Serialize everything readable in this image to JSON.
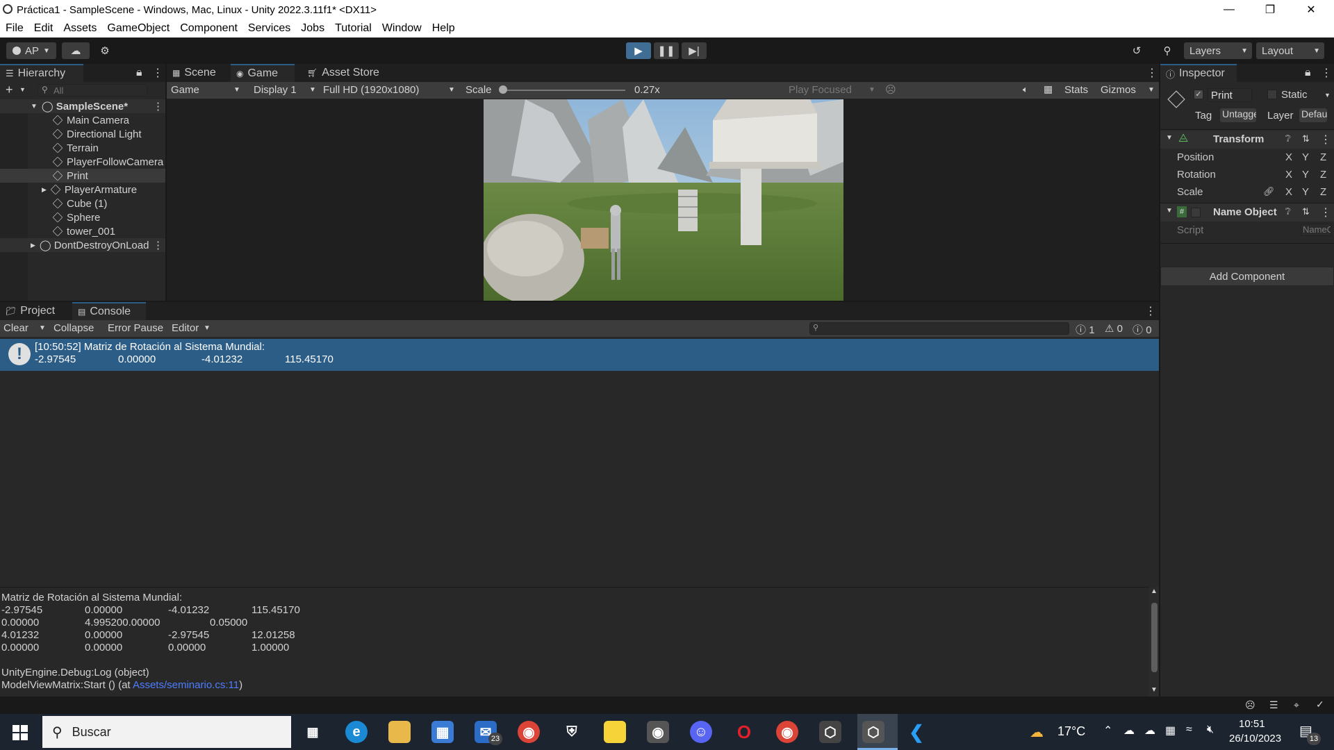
{
  "window": {
    "title": "Práctica1 - SampleScene - Windows, Mac, Linux - Unity 2022.3.11f1* <DX11>",
    "minimize_icon": "minimize-icon",
    "maximize_icon": "restore-icon",
    "close_icon": "close-icon"
  },
  "menu": [
    "File",
    "Edit",
    "Assets",
    "GameObject",
    "Component",
    "Services",
    "Jobs",
    "Tutorial",
    "Window",
    "Help"
  ],
  "toolbar": {
    "account": "AP",
    "layers": "Layers",
    "layout": "Layout"
  },
  "hierarchy": {
    "tab": "Hierarchy",
    "search_placeholder": "All",
    "scene": "SampleScene*",
    "items": [
      "Main Camera",
      "Directional Light",
      "Terrain",
      "PlayerFollowCamera",
      "Print",
      "PlayerArmature",
      "Cube (1)",
      "Sphere",
      "tower_001"
    ],
    "dont_destroy": "DontDestroyOnLoad"
  },
  "game_view": {
    "tabs": [
      "Scene",
      "Game",
      "Asset Store"
    ],
    "mode": "Game",
    "display": "Display 1",
    "resolution": "Full HD (1920x1080)",
    "scale_label": "Scale",
    "scale_value": "0.27x",
    "play_focused": "Play Focused",
    "stats": "Stats",
    "gizmos": "Gizmos"
  },
  "inspector": {
    "tab": "Inspector",
    "object_name": "Print",
    "static_label": "Static",
    "tag_label": "Tag",
    "tag_value": "Untagged",
    "layer_label": "Layer",
    "layer_value": "Default",
    "transform": "Transform",
    "rows": [
      "Position",
      "Rotation",
      "Scale"
    ],
    "axis": [
      "X",
      "Y",
      "Z"
    ],
    "component": "Name Object",
    "script_label": "Script",
    "script_value": "NameObject",
    "add_component": "Add Component"
  },
  "console": {
    "tabs": [
      "Project",
      "Console"
    ],
    "toolbar": [
      "Clear",
      "Collapse",
      "Error Pause",
      "Editor"
    ],
    "counts": {
      "info": "1",
      "warn": "0",
      "error": "0"
    },
    "log_line1": "[10:50:52] Matriz de Rotación al Sistema Mundial:",
    "log_line2": [
      "-2.97545",
      "0.00000",
      "-4.01232",
      "115.45170"
    ],
    "detail_header": "Matriz de Rotación al Sistema Mundial:",
    "detail_rows": [
      [
        "-2.97545",
        "0.00000",
        "-4.01232",
        "115.45170"
      ],
      [
        "0.00000",
        "4.995200.00000",
        "0.05000",
        ""
      ],
      [
        "4.01232",
        "0.00000",
        "-2.97545",
        "12.01258"
      ],
      [
        "0.00000",
        "0.00000",
        "0.00000",
        "1.00000"
      ]
    ],
    "stack1": "UnityEngine.Debug:Log (object)",
    "stack2_prefix": "ModelViewMatrix:Start () (at ",
    "stack2_link": "Assets/seminario.cs:11",
    "stack2_suffix": ")"
  },
  "taskbar": {
    "search": "Buscar",
    "mail_badge": "23",
    "temperature": "17°C",
    "time": "10:51",
    "date": "26/10/2023",
    "notif_badge": "13"
  }
}
